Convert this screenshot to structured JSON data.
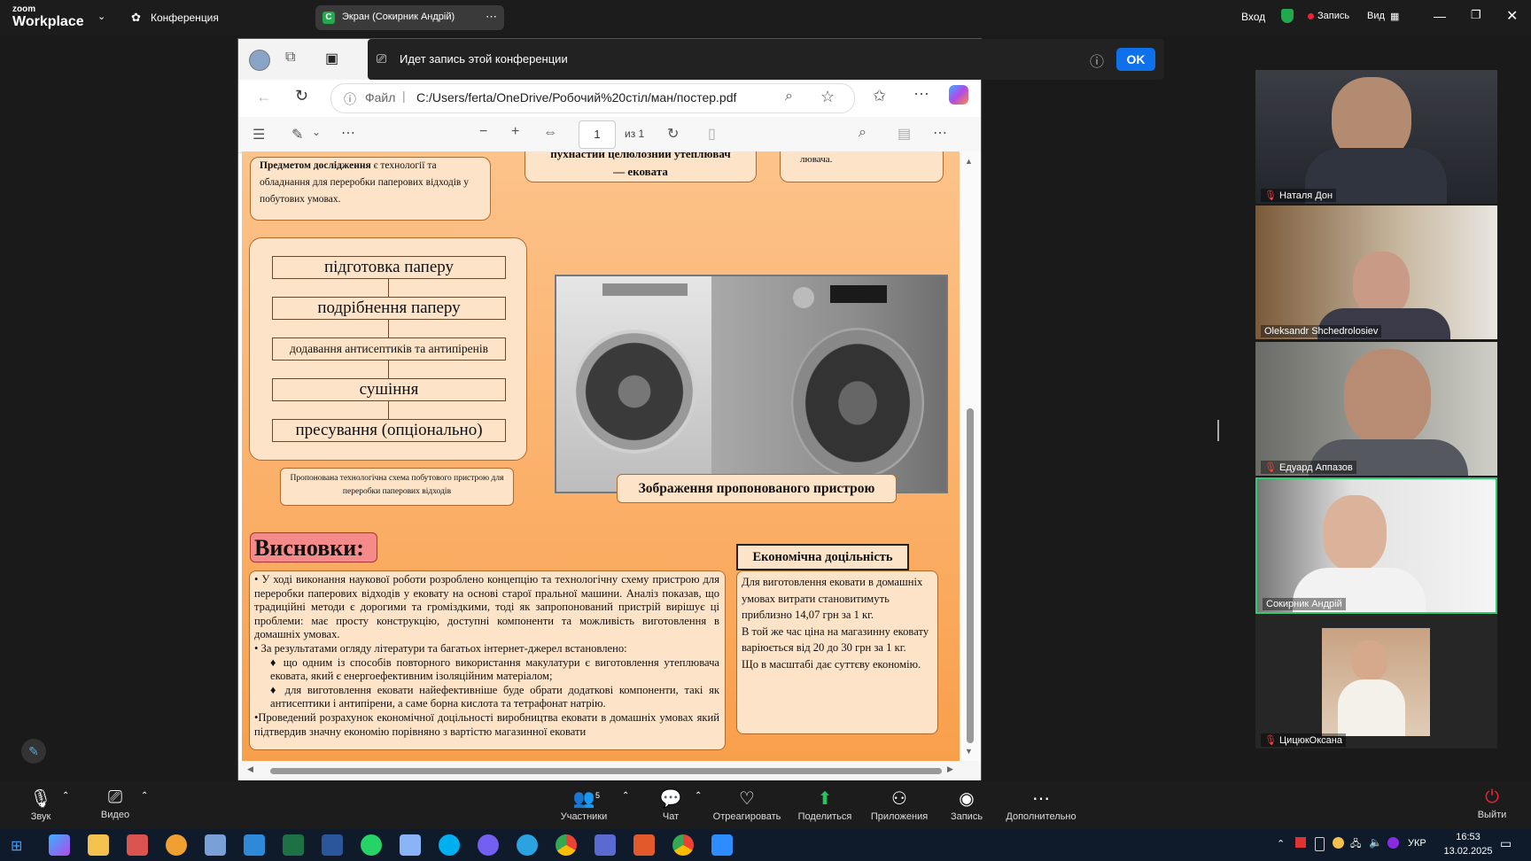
{
  "zoom": {
    "logo_top": "zoom",
    "logo_bottom": "Workplace",
    "conference_label": "Конференция",
    "share_label": "Экран (Сокирник Андрій)",
    "share_badge": "С",
    "login": "Вход",
    "record_label": "Запись",
    "view_label": "Вид"
  },
  "recording_banner": {
    "text": "Идет запись этой конференции",
    "ok": "OK"
  },
  "browser": {
    "file_label": "Файл",
    "url": "C:/Users/ferta/OneDrive/Робочий%20стіл/ман/постер.pdf",
    "page_current": "1",
    "page_of": "из 1"
  },
  "poster": {
    "subject_bold": "Предметом дослідження",
    "subject_rest": " є технології та обладнання для переробки паперових відходів у побутових умовах.",
    "top_center": "пухнастий целюлозний утеплювач — ековата",
    "top_right": "лювача.",
    "steps": [
      "підготовка паперу",
      "подрібнення паперу",
      "додавання антисептиків та антипіренів",
      "сушіння",
      "пресування (опціонально)"
    ],
    "scheme_caption": "Пропонована технологічна схема побутового пристрою для переробки паперових відходів",
    "image_caption": "Зображення пропонованого пристрою",
    "conclusions_title": "Висновки:",
    "conclusions_p1": "• У ході виконання наукової роботи розроблено концепцію та технологічну схему пристрою для переробки паперових відходів у ековату на основі старої пральної машини. Аналіз показав, що традиційні методи є дорогими та громіздкими, тоді як запропонований пристрій вирішує ці проблеми: має просту конструкцію, доступні компоненти та можливість виготовлення в домашніх умовах.",
    "conclusions_p2": "• За результатами огляду літератури та багатьох інтернет-джерел встановлено:",
    "conclusions_p3": "♦ що одним із способів повторного використання макулатури є виготовлення утеплювача ековата, який є енергоефективним ізоляційним матеріалом;",
    "conclusions_p4": "♦ для виготовлення ековати найефективніше буде обрати додаткові компоненти, такі як антисептики і антипірени, а саме борна кислота та тетрафонат натрію.",
    "conclusions_p5": "•Проведений розрахунок економічної доцільності виробництва ековати в домашніх умовах який підтвердив значну економію порівняно з вартістю магазинної ековати",
    "econ_title": "Економічна доцільність",
    "econ_p1": "Для виготовлення ековати в домашніх умовах витрати становитимуть приблизно 14,07 грн за 1 кг.",
    "econ_p2": "В той же час ціна на магазинну ековату варіюється від 20 до 30 грн за 1 кг.",
    "econ_p3": "Що в масштабі дає суттєву економію."
  },
  "participants": [
    {
      "name": "Наталя Дон"
    },
    {
      "name": "Oleksandr Shchedrolosiev"
    },
    {
      "name": "Едуард Аппазов"
    },
    {
      "name": "Сокирник Андрій"
    },
    {
      "name": "ЦицюкОксана"
    }
  ],
  "toolbar": {
    "audio": "Звук",
    "video": "Видео",
    "participants": "Участники",
    "participants_count": "5",
    "chat": "Чат",
    "react": "Отреагировать",
    "share": "Поделиться",
    "apps": "Приложения",
    "record": "Запись",
    "more": "Дополнительно",
    "leave": "Выйти"
  },
  "taskbar": {
    "lang": "УКР",
    "time": "16:53",
    "date": "13.02.2025"
  },
  "colors": {
    "accent_blue": "#0e71eb",
    "active_green": "#22a94f",
    "poster_orange": "#fbb069"
  }
}
